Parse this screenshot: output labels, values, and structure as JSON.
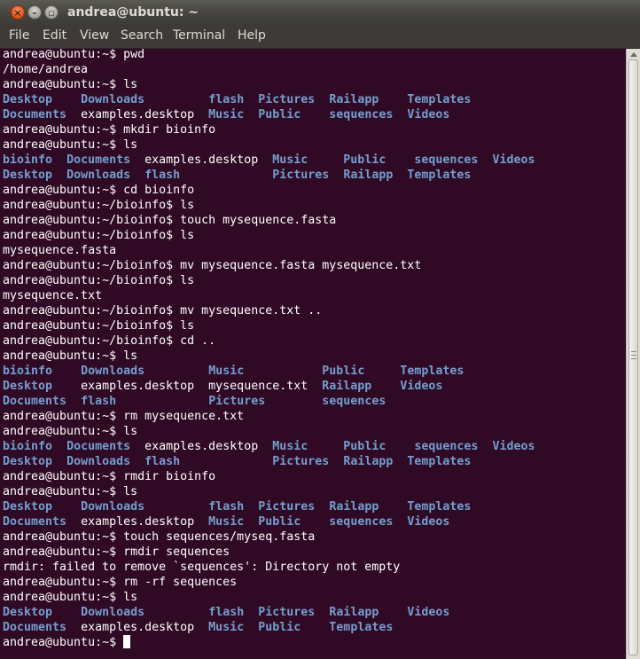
{
  "window": {
    "title": "andrea@ubuntu: ~",
    "close_glyph": "×",
    "min_glyph": "–",
    "max_glyph": "▫"
  },
  "menubar": [
    {
      "id": "file",
      "label": "File"
    },
    {
      "id": "edit",
      "label": "Edit"
    },
    {
      "id": "view",
      "label": "View"
    },
    {
      "id": "search",
      "label": "Search"
    },
    {
      "id": "terminal",
      "label": "Terminal"
    },
    {
      "id": "help",
      "label": "Help"
    }
  ],
  "terminal": {
    "colors": {
      "background": "#300a24",
      "foreground": "#ffffff",
      "directory": "#729fcf"
    },
    "final_prompt": "andrea@ubuntu:~$ ",
    "lines": [
      [
        {
          "t": "andrea@ubuntu:~$ pwd"
        }
      ],
      [
        {
          "t": "/home/andrea"
        }
      ],
      [
        {
          "t": "andrea@ubuntu:~$ ls"
        }
      ],
      [
        {
          "t": "Desktop",
          "d": 1
        },
        {
          "t": "    "
        },
        {
          "t": "Downloads",
          "d": 1
        },
        {
          "t": "         "
        },
        {
          "t": "flash",
          "d": 1
        },
        {
          "t": "  "
        },
        {
          "t": "Pictures",
          "d": 1
        },
        {
          "t": "  "
        },
        {
          "t": "Railapp",
          "d": 1
        },
        {
          "t": "    "
        },
        {
          "t": "Templates",
          "d": 1
        }
      ],
      [
        {
          "t": "Documents",
          "d": 1
        },
        {
          "t": "  examples.desktop  "
        },
        {
          "t": "Music",
          "d": 1
        },
        {
          "t": "  "
        },
        {
          "t": "Public",
          "d": 1
        },
        {
          "t": "    "
        },
        {
          "t": "sequences",
          "d": 1
        },
        {
          "t": "  "
        },
        {
          "t": "Videos",
          "d": 1
        }
      ],
      [
        {
          "t": "andrea@ubuntu:~$ mkdir bioinfo"
        }
      ],
      [
        {
          "t": "andrea@ubuntu:~$ ls"
        }
      ],
      [
        {
          "t": "bioinfo",
          "d": 1
        },
        {
          "t": "  "
        },
        {
          "t": "Documents",
          "d": 1
        },
        {
          "t": "  examples.desktop  "
        },
        {
          "t": "Music",
          "d": 1
        },
        {
          "t": "     "
        },
        {
          "t": "Public",
          "d": 1
        },
        {
          "t": "    "
        },
        {
          "t": "sequences",
          "d": 1
        },
        {
          "t": "  "
        },
        {
          "t": "Videos",
          "d": 1
        }
      ],
      [
        {
          "t": "Desktop",
          "d": 1
        },
        {
          "t": "  "
        },
        {
          "t": "Downloads",
          "d": 1
        },
        {
          "t": "  "
        },
        {
          "t": "flash",
          "d": 1
        },
        {
          "t": "             "
        },
        {
          "t": "Pictures",
          "d": 1
        },
        {
          "t": "  "
        },
        {
          "t": "Railapp",
          "d": 1
        },
        {
          "t": "  "
        },
        {
          "t": "Templates",
          "d": 1
        }
      ],
      [
        {
          "t": "andrea@ubuntu:~$ cd bioinfo"
        }
      ],
      [
        {
          "t": "andrea@ubuntu:~/bioinfo$ ls"
        }
      ],
      [
        {
          "t": "andrea@ubuntu:~/bioinfo$ touch mysequence.fasta"
        }
      ],
      [
        {
          "t": "andrea@ubuntu:~/bioinfo$ ls"
        }
      ],
      [
        {
          "t": "mysequence.fasta"
        }
      ],
      [
        {
          "t": "andrea@ubuntu:~/bioinfo$ mv mysequence.fasta mysequence.txt"
        }
      ],
      [
        {
          "t": "andrea@ubuntu:~/bioinfo$ ls"
        }
      ],
      [
        {
          "t": "mysequence.txt"
        }
      ],
      [
        {
          "t": "andrea@ubuntu:~/bioinfo$ mv mysequence.txt .."
        }
      ],
      [
        {
          "t": "andrea@ubuntu:~/bioinfo$ ls"
        }
      ],
      [
        {
          "t": "andrea@ubuntu:~/bioinfo$ cd .."
        }
      ],
      [
        {
          "t": "andrea@ubuntu:~$ ls"
        }
      ],
      [
        {
          "t": "bioinfo",
          "d": 1
        },
        {
          "t": "    "
        },
        {
          "t": "Downloads",
          "d": 1
        },
        {
          "t": "         "
        },
        {
          "t": "Music",
          "d": 1
        },
        {
          "t": "           "
        },
        {
          "t": "Public",
          "d": 1
        },
        {
          "t": "     "
        },
        {
          "t": "Templates",
          "d": 1
        }
      ],
      [
        {
          "t": "Desktop",
          "d": 1
        },
        {
          "t": "    examples.desktop  mysequence.txt  "
        },
        {
          "t": "Railapp",
          "d": 1
        },
        {
          "t": "    "
        },
        {
          "t": "Videos",
          "d": 1
        }
      ],
      [
        {
          "t": "Documents",
          "d": 1
        },
        {
          "t": "  "
        },
        {
          "t": "flash",
          "d": 1
        },
        {
          "t": "             "
        },
        {
          "t": "Pictures",
          "d": 1
        },
        {
          "t": "        "
        },
        {
          "t": "sequences",
          "d": 1
        }
      ],
      [
        {
          "t": "andrea@ubuntu:~$ rm mysequence.txt"
        }
      ],
      [
        {
          "t": "andrea@ubuntu:~$ ls"
        }
      ],
      [
        {
          "t": "bioinfo",
          "d": 1
        },
        {
          "t": "  "
        },
        {
          "t": "Documents",
          "d": 1
        },
        {
          "t": "  examples.desktop  "
        },
        {
          "t": "Music",
          "d": 1
        },
        {
          "t": "     "
        },
        {
          "t": "Public",
          "d": 1
        },
        {
          "t": "    "
        },
        {
          "t": "sequences",
          "d": 1
        },
        {
          "t": "  "
        },
        {
          "t": "Videos",
          "d": 1
        }
      ],
      [
        {
          "t": "Desktop",
          "d": 1
        },
        {
          "t": "  "
        },
        {
          "t": "Downloads",
          "d": 1
        },
        {
          "t": "  "
        },
        {
          "t": "flash",
          "d": 1
        },
        {
          "t": "             "
        },
        {
          "t": "Pictures",
          "d": 1
        },
        {
          "t": "  "
        },
        {
          "t": "Railapp",
          "d": 1
        },
        {
          "t": "  "
        },
        {
          "t": "Templates",
          "d": 1
        }
      ],
      [
        {
          "t": "andrea@ubuntu:~$ rmdir bioinfo"
        }
      ],
      [
        {
          "t": "andrea@ubuntu:~$ ls"
        }
      ],
      [
        {
          "t": "Desktop",
          "d": 1
        },
        {
          "t": "    "
        },
        {
          "t": "Downloads",
          "d": 1
        },
        {
          "t": "         "
        },
        {
          "t": "flash",
          "d": 1
        },
        {
          "t": "  "
        },
        {
          "t": "Pictures",
          "d": 1
        },
        {
          "t": "  "
        },
        {
          "t": "Railapp",
          "d": 1
        },
        {
          "t": "    "
        },
        {
          "t": "Templates",
          "d": 1
        }
      ],
      [
        {
          "t": "Documents",
          "d": 1
        },
        {
          "t": "  examples.desktop  "
        },
        {
          "t": "Music",
          "d": 1
        },
        {
          "t": "  "
        },
        {
          "t": "Public",
          "d": 1
        },
        {
          "t": "    "
        },
        {
          "t": "sequences",
          "d": 1
        },
        {
          "t": "  "
        },
        {
          "t": "Videos",
          "d": 1
        }
      ],
      [
        {
          "t": "andrea@ubuntu:~$ touch sequences/myseq.fasta"
        }
      ],
      [
        {
          "t": "andrea@ubuntu:~$ rmdir sequences"
        }
      ],
      [
        {
          "t": "rmdir: failed to remove `sequences': Directory not empty"
        }
      ],
      [
        {
          "t": "andrea@ubuntu:~$ rm -rf sequences"
        }
      ],
      [
        {
          "t": "andrea@ubuntu:~$ ls"
        }
      ],
      [
        {
          "t": "Desktop",
          "d": 1
        },
        {
          "t": "    "
        },
        {
          "t": "Downloads",
          "d": 1
        },
        {
          "t": "         "
        },
        {
          "t": "flash",
          "d": 1
        },
        {
          "t": "  "
        },
        {
          "t": "Pictures",
          "d": 1
        },
        {
          "t": "  "
        },
        {
          "t": "Railapp",
          "d": 1
        },
        {
          "t": "    "
        },
        {
          "t": "Videos",
          "d": 1
        }
      ],
      [
        {
          "t": "Documents",
          "d": 1
        },
        {
          "t": "  examples.desktop  "
        },
        {
          "t": "Music",
          "d": 1
        },
        {
          "t": "  "
        },
        {
          "t": "Public",
          "d": 1
        },
        {
          "t": "    "
        },
        {
          "t": "Templates",
          "d": 1
        }
      ]
    ]
  }
}
